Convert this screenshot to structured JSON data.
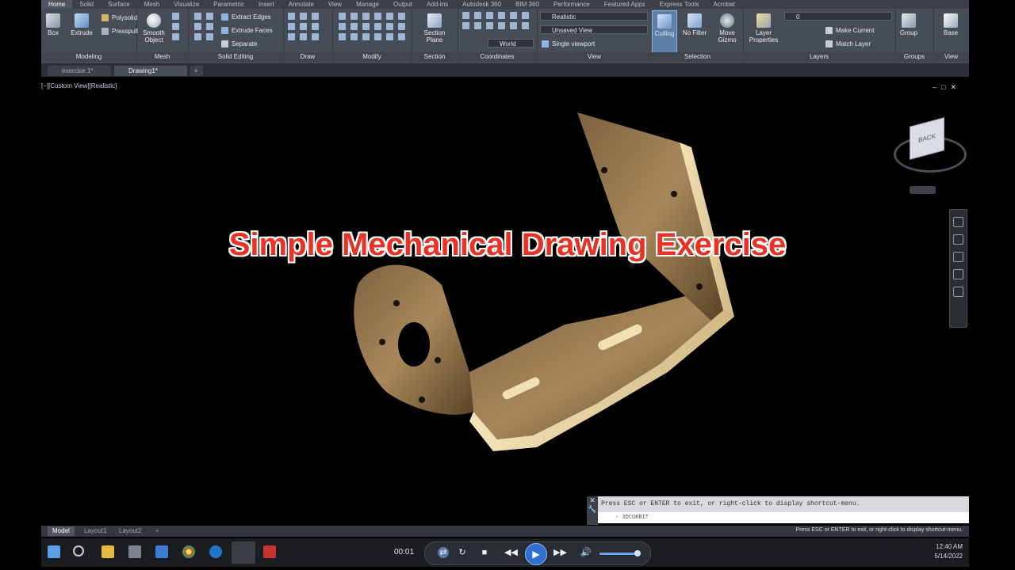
{
  "ribbon_tabs": [
    "Home",
    "Solid",
    "Surface",
    "Mesh",
    "Visualize",
    "Parametric",
    "Insert",
    "Annotate",
    "View",
    "Manage",
    "Output",
    "Add-ins",
    "Autodesk 360",
    "BIM 360",
    "Performance",
    "Featured Apps",
    "Express Tools",
    "Acrobat"
  ],
  "panels": {
    "modeling": {
      "title": "Modeling",
      "box": "Box",
      "extrude": "Extrude",
      "polysolid": "Polysolid",
      "presspull": "Presspull"
    },
    "mesh": {
      "title": "Mesh",
      "smooth": "Smooth Object"
    },
    "solid_editing": {
      "title": "Solid Editing",
      "extract": "Extract Edges",
      "extrude_faces": "Extrude Faces",
      "separate": "Separate"
    },
    "draw": {
      "title": "Draw"
    },
    "modify": {
      "title": "Modify"
    },
    "section": {
      "title": "Section",
      "plane": "Section Plane"
    },
    "coordinates": {
      "title": "Coordinates",
      "world": "World"
    },
    "view": {
      "title": "View",
      "visual_style": "Realistic",
      "named_view": "Unsaved View",
      "viewport": "Single viewport"
    },
    "selection": {
      "title": "Selection",
      "culling": "Culling",
      "no_filter": "No Filter",
      "move_gizmo": "Move Gizmo"
    },
    "layers": {
      "title": "Layers",
      "properties": "Layer Properties",
      "layer_value": "0",
      "make_current": "Make Current",
      "match_layer": "Match Layer"
    },
    "groups": {
      "title": "Groups",
      "group": "Group"
    },
    "view2": {
      "title": "View",
      "base": "Base"
    }
  },
  "doc_tabs": [
    "exercise 1*",
    "Drawing1*"
  ],
  "viewport_label": "[−][Custom View][Realistic]",
  "overlay_title": "Simple Mechanical Drawing Exercise",
  "viewcube_face": "BACK",
  "command": {
    "history": "Press ESC or ENTER to exit, or right-click to display shortcut-menu.",
    "input": "- 3DCORBIT"
  },
  "layout_tabs": [
    "Model",
    "Layout1",
    "Layout2"
  ],
  "status_message": "Press ESC or ENTER to exit, or right-click to display shortcut-menu.",
  "media": {
    "timecode": "00:01"
  },
  "clock": {
    "time": "12:40 AM",
    "date": "5/14/2022"
  },
  "colors": {
    "ribbon": "#474d57",
    "title_red": "#e83225",
    "bracket": "#a88757"
  }
}
